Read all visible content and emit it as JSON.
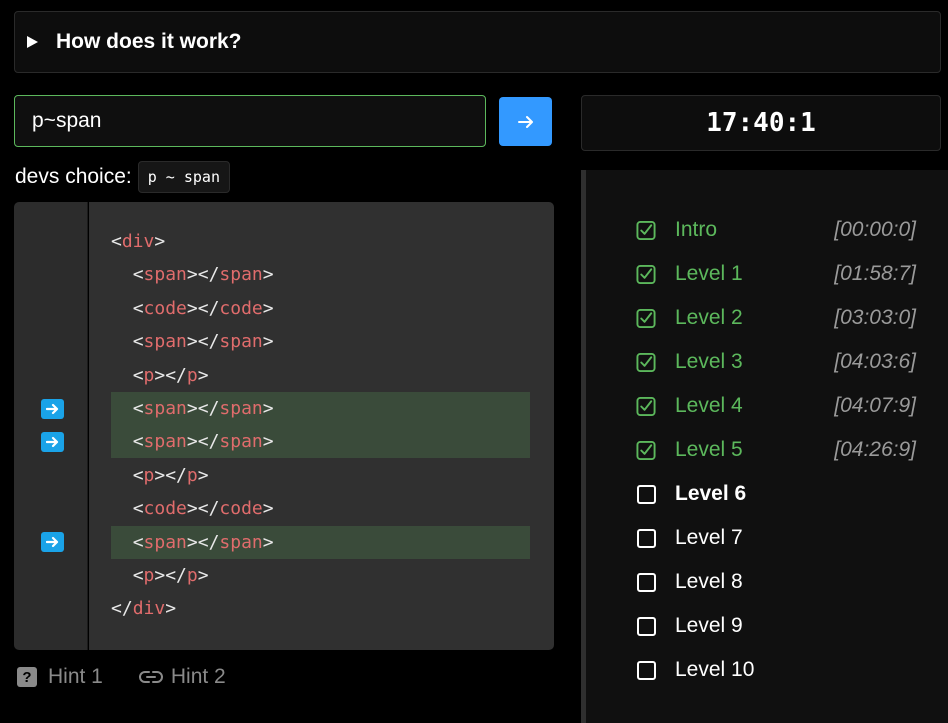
{
  "faq": {
    "question": "How does it work?"
  },
  "selector_input": {
    "value": "p~span"
  },
  "timer": {
    "value": "17:40:1"
  },
  "devs_choice": {
    "label": "devs choice:",
    "code": "p ~ span"
  },
  "code_lines": [
    {
      "indent": 0,
      "tag": "div",
      "type": "open",
      "highlight": false
    },
    {
      "indent": 1,
      "tag": "span",
      "type": "pair",
      "highlight": false
    },
    {
      "indent": 1,
      "tag": "code",
      "type": "pair",
      "highlight": false
    },
    {
      "indent": 1,
      "tag": "span",
      "type": "pair",
      "highlight": false
    },
    {
      "indent": 1,
      "tag": "p",
      "type": "pair",
      "highlight": false
    },
    {
      "indent": 1,
      "tag": "span",
      "type": "pair",
      "highlight": true
    },
    {
      "indent": 1,
      "tag": "span",
      "type": "pair",
      "highlight": true
    },
    {
      "indent": 1,
      "tag": "p",
      "type": "pair",
      "highlight": false
    },
    {
      "indent": 1,
      "tag": "code",
      "type": "pair",
      "highlight": false
    },
    {
      "indent": 1,
      "tag": "span",
      "type": "pair",
      "highlight": true
    },
    {
      "indent": 1,
      "tag": "p",
      "type": "pair",
      "highlight": false
    },
    {
      "indent": 0,
      "tag": "div",
      "type": "close",
      "highlight": false
    }
  ],
  "hints": [
    {
      "label": "Hint 1",
      "icon": "question-icon"
    },
    {
      "label": "Hint 2",
      "icon": "link-icon"
    }
  ],
  "levels": [
    {
      "name": "Intro",
      "time": "[00:00:0]",
      "status": "done"
    },
    {
      "name": "Level 1",
      "time": "[01:58:7]",
      "status": "done"
    },
    {
      "name": "Level 2",
      "time": "[03:03:0]",
      "status": "done"
    },
    {
      "name": "Level 3",
      "time": "[04:03:6]",
      "status": "done"
    },
    {
      "name": "Level 4",
      "time": "[04:07:9]",
      "status": "done"
    },
    {
      "name": "Level 5",
      "time": "[04:26:9]",
      "status": "done"
    },
    {
      "name": "Level 6",
      "time": "",
      "status": "current"
    },
    {
      "name": "Level 7",
      "time": "",
      "status": "todo"
    },
    {
      "name": "Level 8",
      "time": "",
      "status": "todo"
    },
    {
      "name": "Level 9",
      "time": "",
      "status": "todo"
    },
    {
      "name": "Level 10",
      "time": "",
      "status": "todo"
    }
  ],
  "colors": {
    "accent": "#3399ff",
    "done": "#5cb85c",
    "tag": "#e06c6c",
    "highlight": "#3a4b3a",
    "marker": "#1aa3e8"
  }
}
